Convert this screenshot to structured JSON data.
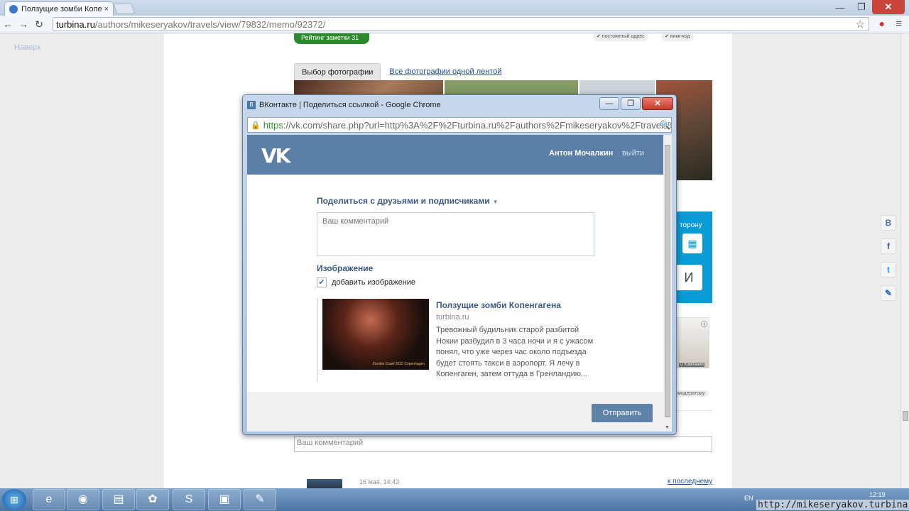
{
  "browser": {
    "tab_title": "Ползущие зомби Копенг",
    "tab_close": "×",
    "address_domain": "turbina.ru",
    "address_path": "/authors/mikeseryakov/travels/view/79832/memo/92372/",
    "back": "←",
    "forward": "→",
    "reload": "↻",
    "star": "☆",
    "menu": "≡",
    "minimize": "—",
    "restore": "❐",
    "close": "✕"
  },
  "page": {
    "naverh": "Наверх",
    "rating_label": "Рейтинг заметки   31",
    "chip_address": "✔ постоянный адрес",
    "chip_wiki": "✔ вики-код",
    "tab_photo_select": "Выбор фотографии",
    "tab_all_photos": "Все фотографии одной лентой",
    "sidebar_text": "торону",
    "sidebar_button": "И",
    "ad_label": "О Компании",
    "ad_info": "ⓘ",
    "moderator": "модератору",
    "comment_placeholder": "Ваш комментарий",
    "comment_date": "16 мая, 14:43",
    "last_link": "к последнему"
  },
  "social": [
    "В",
    "f",
    "t",
    "✎"
  ],
  "popup": {
    "title": "ВКонтакте | Поделиться ссылкой - Google Chrome",
    "favicon": "В",
    "url_https": "https",
    "url_rest": "://vk.com/share.php?url=http%3A%2F%2Fturbina.ru%2Fauthors%2Fmikeseryakov%2Ftravels%",
    "zoom": "🔍",
    "minimize": "—",
    "restore": "❐",
    "close": "✕",
    "vk": {
      "logo": "VK",
      "user_name": "Антон Мочалкин",
      "exit": "выйти",
      "share_title": "Поделиться с друзьями и подписчиками",
      "caret": "▼",
      "comment_placeholder": "Ваш комментарий",
      "image_section": "Изображение",
      "checkbox_label": "добавить изображение",
      "checkbox_mark": "✔",
      "preview_title": "Ползущие зомби Копенгагена",
      "preview_domain": "turbina.ru",
      "preview_desc": "Тревожный будильник старой разбитой Нокии разбудил в 3 часа ночи и я с ужасом понял, что уже через час около подъезда будет стоять такси в аэропорт. Я лечу в Копенгаген, затем оттуда в Гренландию...",
      "image_caption": "Zombie Crawl 2015 Copenhagen",
      "send_button": "Отправить"
    }
  },
  "taskbar": {
    "start": "⊞",
    "apps": [
      "e",
      "◉",
      "▤",
      "✿",
      "S",
      "▣",
      "✎"
    ],
    "lang": "EN",
    "time": "12:19"
  },
  "watermark": "http://mikeseryakov.turbina.ru",
  "colors": {
    "vk_blue": "#5b7fa6",
    "vk_link": "#3b5a80",
    "rating_green": "#2c8a2c",
    "sidebar_blue": "#0a9ad6"
  }
}
